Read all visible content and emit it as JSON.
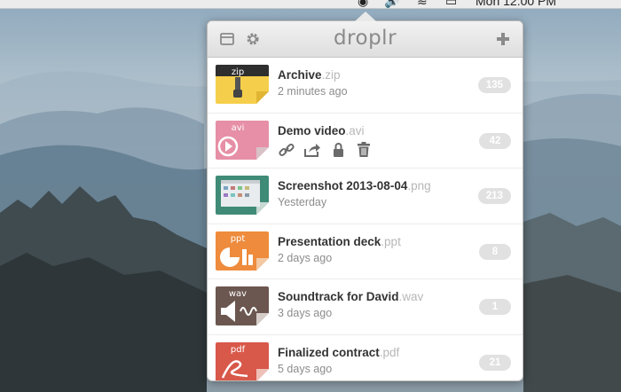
{
  "menubar": {
    "clock": "Mon 12:00 PM"
  },
  "app": {
    "brand": "droplr"
  },
  "files": [
    {
      "name": "Archive",
      "ext": ".zip",
      "thumb_label": "zip",
      "sub": "2 minutes ago",
      "count": "135",
      "thumb_color": "#f5cf4b"
    },
    {
      "name": "Demo video",
      "ext": ".avi",
      "thumb_label": "avi",
      "sub": "",
      "count": "42",
      "thumb_color": "#e68fa6"
    },
    {
      "name": "Screenshot 2013-08-04",
      "ext": ".png",
      "thumb_label": "",
      "sub": "Yesterday",
      "count": "213",
      "thumb_color": "#3f8b78"
    },
    {
      "name": "Presentation deck",
      "ext": ".ppt",
      "thumb_label": "ppt",
      "sub": "2 days ago",
      "count": "8",
      "thumb_color": "#ee8b3c"
    },
    {
      "name": "Soundtrack for David",
      "ext": ".wav",
      "thumb_label": "wav",
      "sub": "3 days ago",
      "count": "1",
      "thumb_color": "#6b5750"
    },
    {
      "name": "Finalized contract",
      "ext": ".pdf",
      "thumb_label": "pdf",
      "sub": "5 days ago",
      "count": "21",
      "thumb_color": "#d8584a"
    }
  ]
}
